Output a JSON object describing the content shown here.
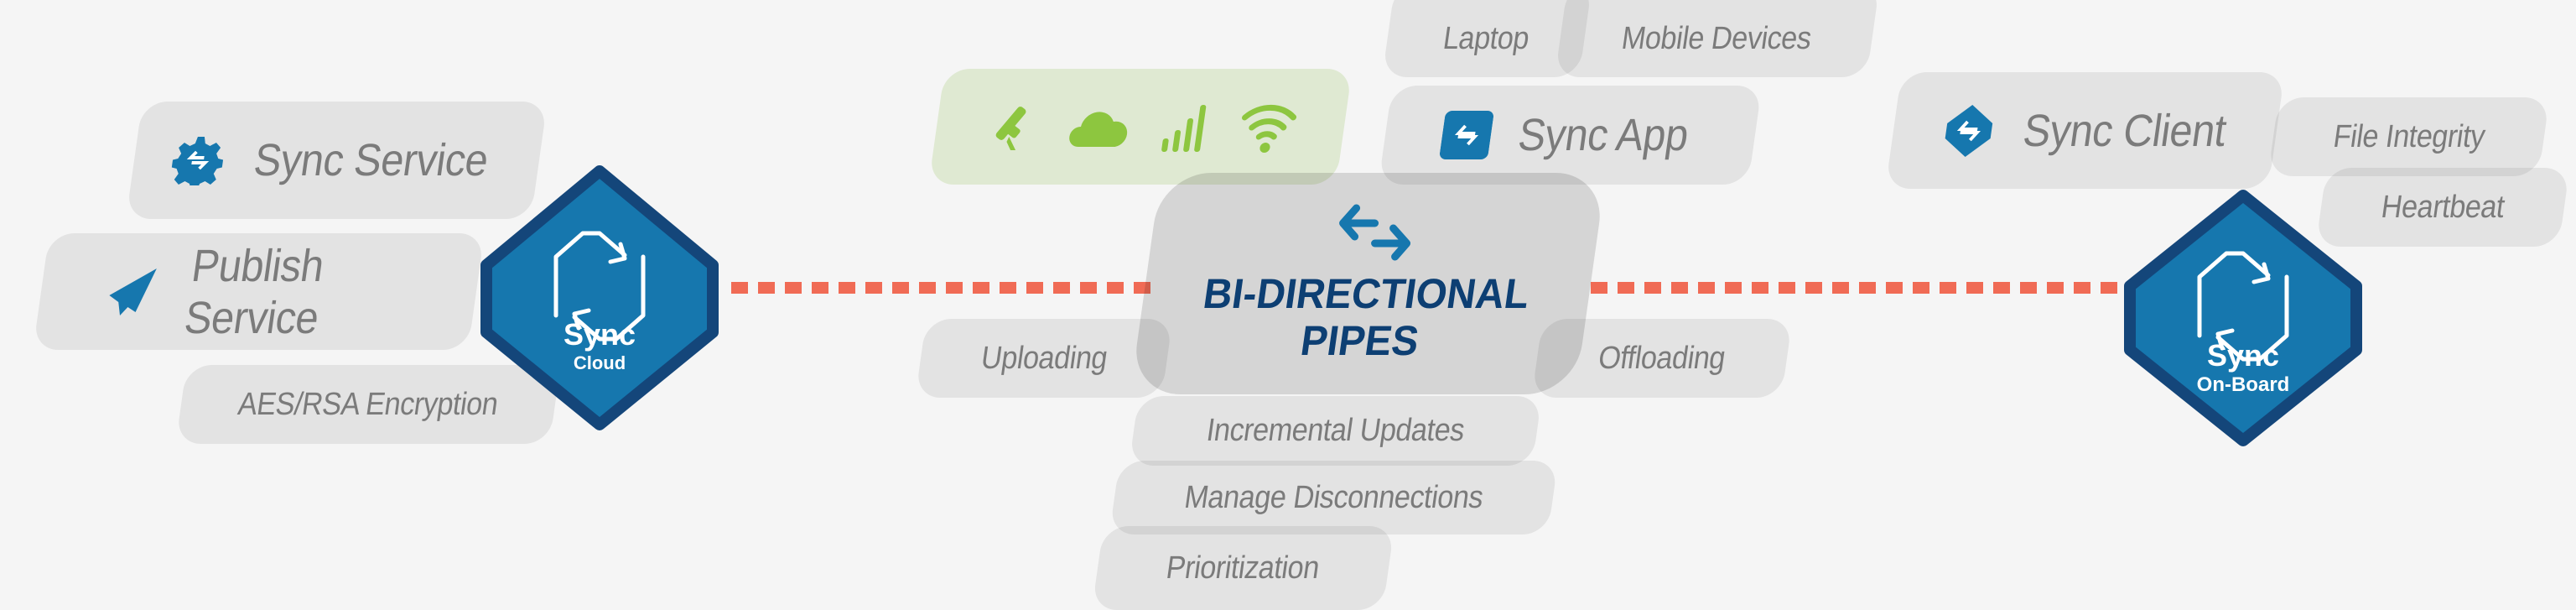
{
  "colors": {
    "background": "#f5f5f5",
    "hex_fill": "#1677ae",
    "hex_border": "#14467a",
    "dash": "#f06b55",
    "green": "#8dc63f",
    "green_bg": "#dfe9d2",
    "title": "#0d3f73",
    "label": "#7b7b7b"
  },
  "left": {
    "sync_service": {
      "label": "Sync Service",
      "icon": "gear-sync-icon"
    },
    "publish_service": {
      "label": "Publish Service",
      "icon": "paper-plane-icon"
    },
    "encryption": {
      "label": "AES/RSA Encryption"
    }
  },
  "cloud_hex": {
    "title": "Sync",
    "subtitle": "Cloud",
    "icon": "sync-cycle-icon"
  },
  "onboard_hex": {
    "title": "Sync",
    "subtitle": "On-Board",
    "icon": "sync-cycle-icon"
  },
  "connectivity": {
    "icons": [
      "satellite-icon",
      "cloud-icon",
      "signal-bars-icon",
      "wifi-icon"
    ]
  },
  "devices": {
    "laptop": "Laptop",
    "mobile": "Mobile Devices",
    "sync_app": "Sync App"
  },
  "pipes": {
    "title_line1": "BI-DIRECTIONAL",
    "title_line2": "PIPES",
    "icon": "bidirectional-arrows-icon",
    "uploading": "Uploading",
    "offloading": "Offloading",
    "features": [
      "Incremental Updates",
      "Manage Disconnections",
      "Prioritization"
    ]
  },
  "right": {
    "sync_client": "Sync Client",
    "file_integrity": "File Integrity",
    "heartbeat": "Heartbeat"
  }
}
